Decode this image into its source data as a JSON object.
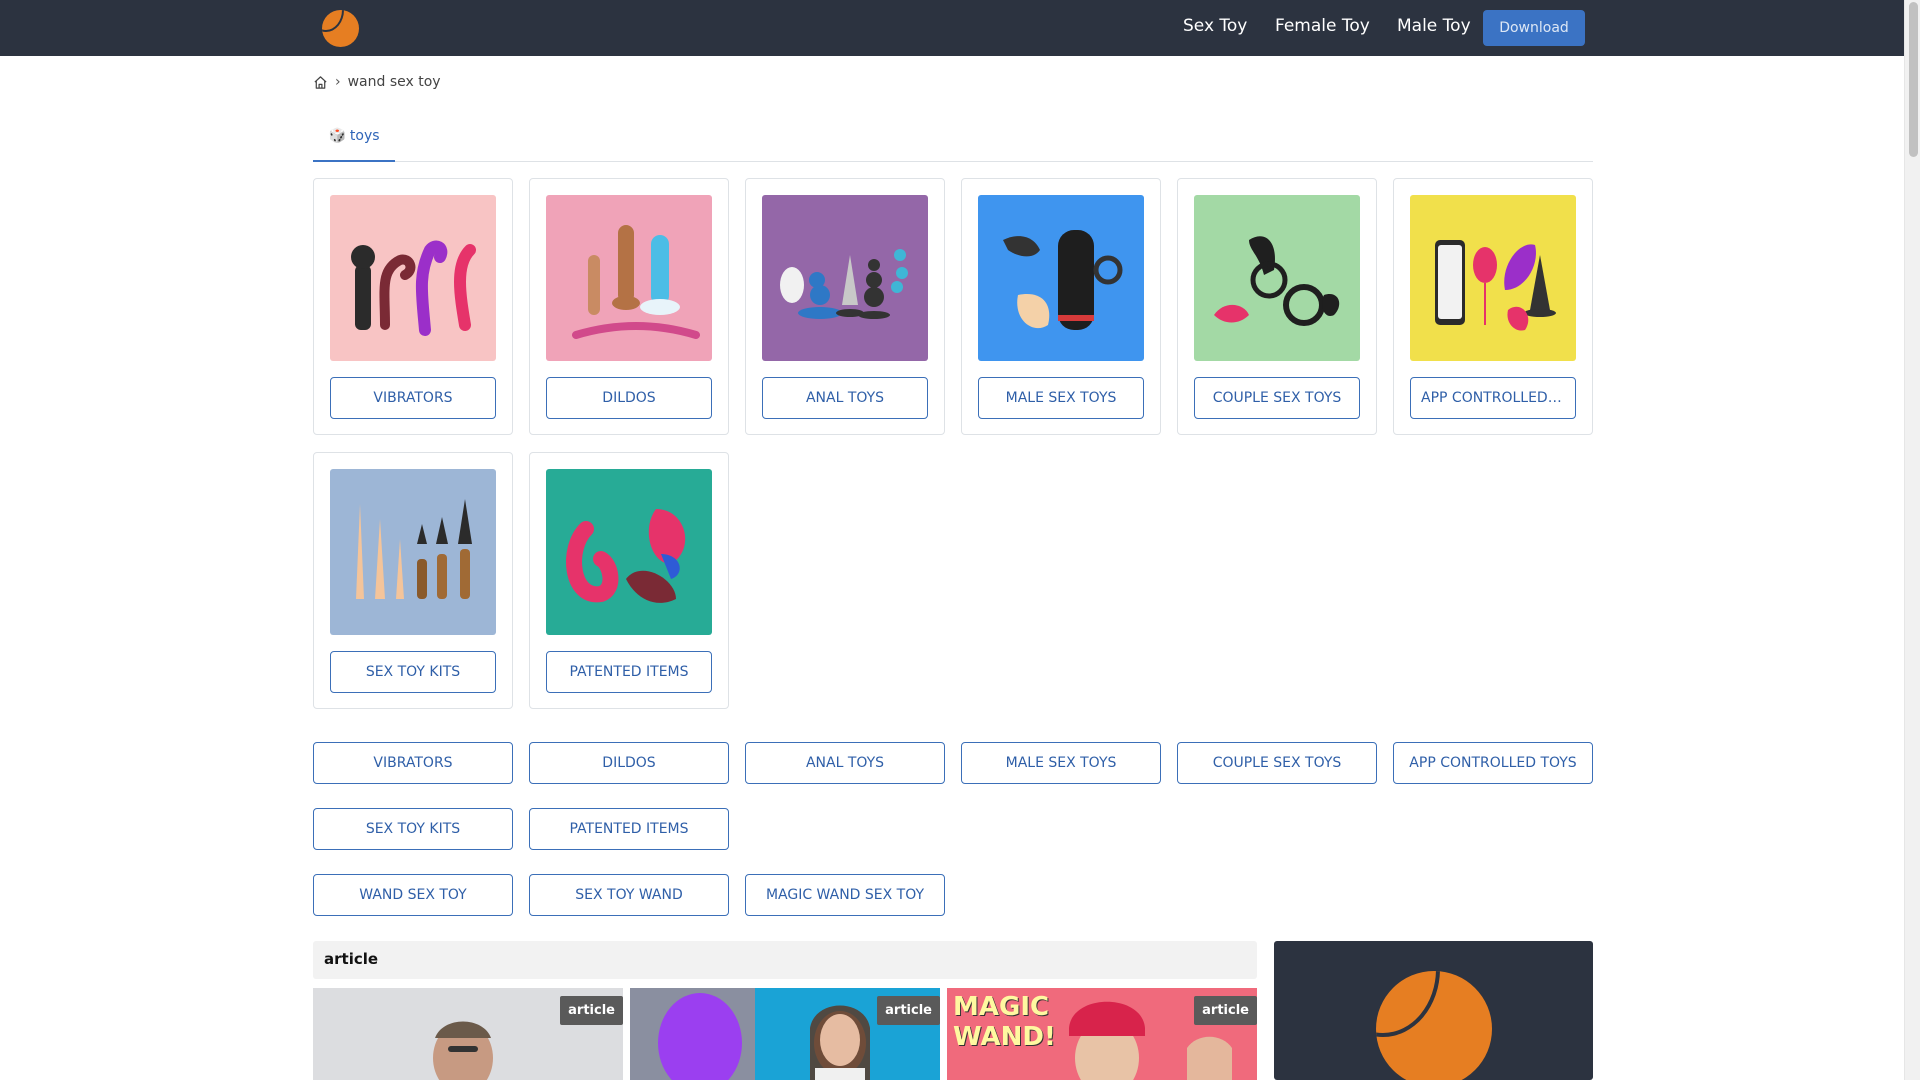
{
  "nav": {
    "links": [
      "Sex Toy",
      "Female Toy",
      "Male Toy"
    ],
    "download_label": "Download"
  },
  "breadcrumb": {
    "current": "wand sex toy"
  },
  "tabs": [
    {
      "label": "toys",
      "icon": "dice-icon"
    }
  ],
  "categories": [
    {
      "label": "VIBRATORS",
      "bg": "#f8c4c4"
    },
    {
      "label": "DILDOS",
      "bg": "#f0a3b8"
    },
    {
      "label": "ANAL TOYS",
      "bg": "#9467a8"
    },
    {
      "label": "MALE SEX TOYS",
      "bg": "#3f95ef"
    },
    {
      "label": "COUPLE SEX TOYS",
      "bg": "#a3d9a5"
    },
    {
      "label": "APP CONTROLLED TOYS",
      "bg": "#f1e04b"
    },
    {
      "label": "SEX TOY KITS",
      "bg": "#9db6d6"
    },
    {
      "label": "PATENTED ITEMS",
      "bg": "#27ab96"
    }
  ],
  "category_links": [
    "VIBRATORS",
    "DILDOS",
    "ANAL TOYS",
    "MALE SEX TOYS",
    "COUPLE SEX TOYS",
    "APP CONTROLLED TOYS",
    "SEX TOY KITS",
    "PATENTED ITEMS"
  ],
  "related_links": [
    "WAND SEX TOY",
    "SEX TOY WAND",
    "MAGIC WAND SEX TOY"
  ],
  "article_section": {
    "heading": "article",
    "items": [
      {
        "badge": "article"
      },
      {
        "badge": "article"
      },
      {
        "badge": "article",
        "overlay_text": "MAGIC WAND!"
      }
    ]
  },
  "colors": {
    "navbar": "#2c3340",
    "accent": "#3b73c4",
    "logo": "#e67e22"
  }
}
